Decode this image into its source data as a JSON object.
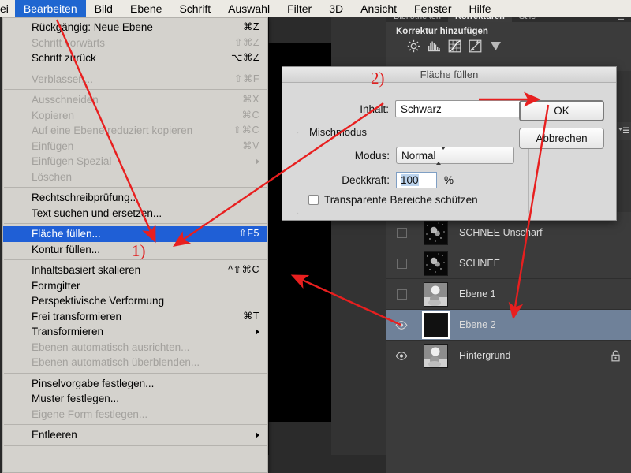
{
  "menubar": {
    "items": [
      {
        "label": "ei",
        "active": false,
        "clipped": true
      },
      {
        "label": "Bearbeiten",
        "active": true
      },
      {
        "label": "Bild",
        "active": false
      },
      {
        "label": "Ebene",
        "active": false
      },
      {
        "label": "Schrift",
        "active": false
      },
      {
        "label": "Auswahl",
        "active": false
      },
      {
        "label": "Filter",
        "active": false
      },
      {
        "label": "3D",
        "active": false
      },
      {
        "label": "Ansicht",
        "active": false
      },
      {
        "label": "Fenster",
        "active": false
      },
      {
        "label": "Hilfe",
        "active": false
      }
    ]
  },
  "edit_menu": {
    "items": [
      {
        "label": "Rückgängig: Neue Ebene",
        "shortcut": "⌘Z",
        "state": "enabled"
      },
      {
        "label": "Schritt vorwärts",
        "shortcut": "⇧⌘Z",
        "state": "disabled"
      },
      {
        "label": "Schritt zurück",
        "shortcut": "⌥⌘Z",
        "state": "enabled"
      },
      {
        "type": "separator"
      },
      {
        "label": "Verblassen...",
        "shortcut": "⇧⌘F",
        "state": "disabled"
      },
      {
        "type": "separator"
      },
      {
        "label": "Ausschneiden",
        "shortcut": "⌘X",
        "state": "disabled"
      },
      {
        "label": "Kopieren",
        "shortcut": "⌘C",
        "state": "disabled"
      },
      {
        "label": "Auf eine Ebene reduziert kopieren",
        "shortcut": "⇧⌘C",
        "state": "disabled"
      },
      {
        "label": "Einfügen",
        "shortcut": "⌘V",
        "state": "disabled"
      },
      {
        "label": "Einfügen Spezial",
        "shortcut": "",
        "state": "disabled",
        "submenu": true
      },
      {
        "label": "Löschen",
        "shortcut": "",
        "state": "disabled"
      },
      {
        "type": "separator"
      },
      {
        "label": "Rechtschreibprüfung...",
        "shortcut": "",
        "state": "enabled"
      },
      {
        "label": "Text suchen und ersetzen...",
        "shortcut": "",
        "state": "enabled"
      },
      {
        "type": "separator"
      },
      {
        "label": "Fläche füllen...",
        "shortcut": "⇧F5",
        "state": "selected"
      },
      {
        "label": "Kontur füllen...",
        "shortcut": "",
        "state": "enabled"
      },
      {
        "type": "separator"
      },
      {
        "label": "Inhaltsbasiert skalieren",
        "shortcut": "^⇧⌘C",
        "state": "enabled"
      },
      {
        "label": "Formgitter",
        "shortcut": "",
        "state": "enabled"
      },
      {
        "label": "Perspektivische Verformung",
        "shortcut": "",
        "state": "enabled"
      },
      {
        "label": "Frei transformieren",
        "shortcut": "⌘T",
        "state": "enabled"
      },
      {
        "label": "Transformieren",
        "shortcut": "",
        "state": "enabled",
        "submenu": true
      },
      {
        "label": "Ebenen automatisch ausrichten...",
        "shortcut": "",
        "state": "disabled"
      },
      {
        "label": "Ebenen automatisch überblenden...",
        "shortcut": "",
        "state": "disabled"
      },
      {
        "type": "separator"
      },
      {
        "label": "Pinselvorgabe festlegen...",
        "shortcut": "",
        "state": "enabled"
      },
      {
        "label": "Muster festlegen...",
        "shortcut": "",
        "state": "enabled"
      },
      {
        "label": "Eigene Form festlegen...",
        "shortcut": "",
        "state": "disabled"
      },
      {
        "type": "separator"
      },
      {
        "label": "Entleeren",
        "shortcut": "",
        "state": "enabled",
        "submenu": true
      },
      {
        "type": "separator"
      }
    ]
  },
  "fill_dialog": {
    "title": "Fläche füllen",
    "content_label": "Inhalt:",
    "content_value": "Schwarz",
    "group_legend": "Mischmodus",
    "mode_label": "Modus:",
    "mode_value": "Normal",
    "opacity_label": "Deckkraft:",
    "opacity_value": "100",
    "opacity_unit": "%",
    "preserve_label": "Transparente Bereiche schützen",
    "ok_label": "OK",
    "cancel_label": "Abbrechen"
  },
  "panels": {
    "tabs": [
      {
        "label": "Bibliotheken",
        "active": false
      },
      {
        "label": "Korrekturen",
        "active": true
      },
      {
        "label": "Stile",
        "active": false
      }
    ],
    "adjustments_title": "Korrektur hinzufügen",
    "adjustment_icons": [
      "brightness-icon",
      "levels-icon",
      "curves-icon",
      "exposure-icon",
      "vibrance-icon"
    ]
  },
  "layers": {
    "rows": [
      {
        "name": "SCHNEE Unscharf",
        "visible": false,
        "selected": false,
        "locked": false,
        "thumb": "snow"
      },
      {
        "name": "SCHNEE",
        "visible": false,
        "selected": false,
        "locked": false,
        "thumb": "snow"
      },
      {
        "name": "Ebene 1",
        "visible": false,
        "selected": false,
        "locked": false,
        "thumb": "photo"
      },
      {
        "name": "Ebene 2",
        "visible": true,
        "selected": true,
        "locked": false,
        "thumb": "black"
      },
      {
        "name": "Hintergrund",
        "visible": true,
        "selected": false,
        "locked": true,
        "thumb": "photo"
      }
    ]
  },
  "annotations": {
    "step1": "1)",
    "step2": "2)",
    "color": "#e81f1f"
  }
}
